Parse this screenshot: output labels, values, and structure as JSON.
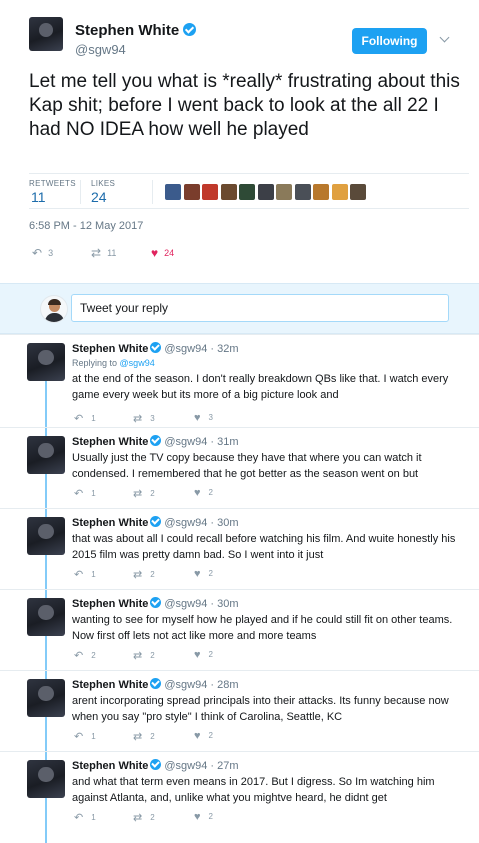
{
  "tweet": {
    "author_name": "Stephen White",
    "handle": "@sgw94",
    "follow_label": "Following",
    "text": "Let me tell you what is *really* frustrating about this Kap shit; before I went back to look at the all 22 I had NO IDEA how well he played",
    "retweets_label": "RETWEETS",
    "retweets": "11",
    "likes_label": "LIKES",
    "likes": "24",
    "timestamp": "6:58 PM - 12 May 2017",
    "reply_count": "3",
    "retweet_count": "11",
    "like_count": "24",
    "liker_colors": [
      "#3b5b8c",
      "#7a3d2c",
      "#c0392b",
      "#6b4a2f",
      "#2e4a36",
      "#3c3f47",
      "#8a7a5a",
      "#4a4f57",
      "#b8782c",
      "#e0a040",
      "#5a4a3a"
    ]
  },
  "reply_box": {
    "placeholder": "Tweet your reply"
  },
  "replies": [
    {
      "name": "Stephen White",
      "handle": "@sgw94",
      "time": "32m",
      "replying_prefix": "Replying to",
      "replying_handle": "@sgw94",
      "text": "at the end of the season. I don't really breakdown QBs like that. I watch every game every week but its more of a big picture look and",
      "replies": "1",
      "retweets": "3",
      "likes": "3"
    },
    {
      "name": "Stephen White",
      "handle": "@sgw94",
      "time": "31m",
      "text": "Usually just the TV copy because they have that where you can watch it condensed. I remembered that he got better as the season went on but",
      "replies": "1",
      "retweets": "2",
      "likes": "2"
    },
    {
      "name": "Stephen White",
      "handle": "@sgw94",
      "time": "30m",
      "text": "that was about all I could recall before watching his film. And wuite honestly his 2015 film was pretty damn bad. So I went into it just",
      "replies": "1",
      "retweets": "2",
      "likes": "2"
    },
    {
      "name": "Stephen White",
      "handle": "@sgw94",
      "time": "30m",
      "text": "wanting to see for myself how he played and if he could still fit on other teams. Now first off lets not act like more and more teams",
      "replies": "2",
      "retweets": "2",
      "likes": "2"
    },
    {
      "name": "Stephen White",
      "handle": "@sgw94",
      "time": "28m",
      "text": "arent incorporating spread principals into their attacks. Its funny because now when you say \"pro style\" I think of Carolina, Seattle, KC",
      "replies": "1",
      "retweets": "2",
      "likes": "2"
    },
    {
      "name": "Stephen White",
      "handle": "@sgw94",
      "time": "27m",
      "text": "and what that term even means in 2017. But I digress. So Im watching him against Atlanta, and, unlike what you mightve heard, he didnt get",
      "replies": "1",
      "retweets": "2",
      "likes": "2"
    }
  ],
  "icons": {
    "reply": "reply-icon",
    "retweet": "retweet-icon",
    "like": "heart-icon",
    "verified": "verified-badge-icon",
    "more": "chevron-down-icon"
  },
  "colors": {
    "accent": "#1da1f2",
    "like_active": "#e0245e",
    "muted": "#657786",
    "reply_bg": "#e8f5fd"
  }
}
